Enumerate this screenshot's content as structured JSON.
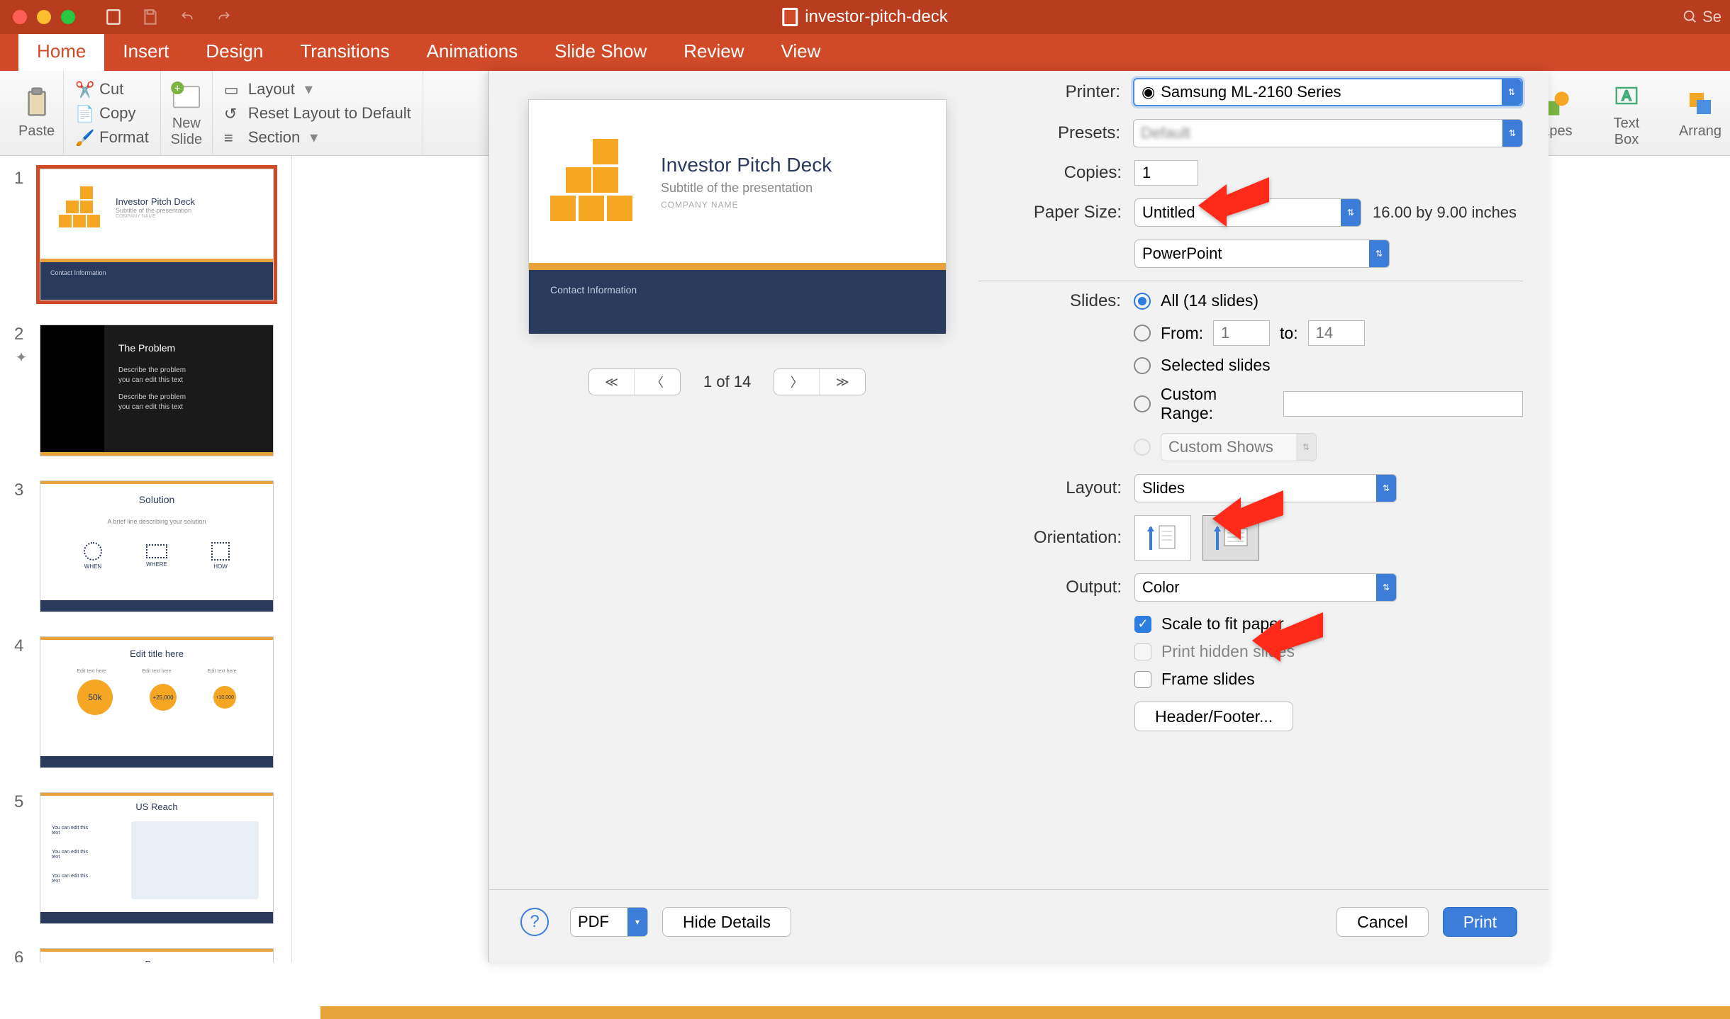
{
  "window": {
    "title": "investor-pitch-deck",
    "search_placeholder": "Se"
  },
  "tabs": {
    "home": "Home",
    "insert": "Insert",
    "design": "Design",
    "transitions": "Transitions",
    "animations": "Animations",
    "slideshow": "Slide Show",
    "review": "Review",
    "view": "View"
  },
  "ribbon": {
    "paste": "Paste",
    "cut": "Cut",
    "copy": "Copy",
    "format": "Format",
    "newslide": "New\nSlide",
    "layout": "Layout",
    "reset": "Reset Layout to Default",
    "section": "Section",
    "shapes": "apes",
    "textbox": "Text\nBox",
    "arrange": "Arrang"
  },
  "thumbs": [
    {
      "n": "1"
    },
    {
      "n": "2"
    },
    {
      "n": "3"
    },
    {
      "n": "4"
    },
    {
      "n": "5"
    },
    {
      "n": "6"
    }
  ],
  "slide2": {
    "title": "The Problem",
    "l1": "Describe the problem",
    "l2": "you can edit this text",
    "l3": "Describe the problem",
    "l4": "you can edit this text"
  },
  "slide3": {
    "title": "Solution",
    "sub": "A brief line describing your solution",
    "c1": "WHEN",
    "c2": "WHERE",
    "c3": "HOW"
  },
  "slide4": {
    "title": "Edit title here",
    "s1": "Edit text here",
    "s2": "Edit text here",
    "s3": "Edit text here",
    "v1": "50k",
    "v2": "+25,000",
    "v3": "+10,000"
  },
  "slide5": {
    "title": "US Reach",
    "t1": "You can edit this text",
    "t2": "You can edit this text",
    "t3": "You can edit this text"
  },
  "slide6": {
    "title": "Press"
  },
  "preview": {
    "title": "Investor Pitch Deck",
    "subtitle": "Subtitle of the presentation",
    "company": "COMPANY NAME",
    "footer": "Contact Information",
    "page_counter": "1 of 14"
  },
  "dialog": {
    "printer_label": "Printer:",
    "printer_value": "Samsung ML-2160 Series",
    "presets_label": "Presets:",
    "copies_label": "Copies:",
    "copies_value": "1",
    "papersize_label": "Paper Size:",
    "papersize_value": "Untitled",
    "papersize_dims": "16.00 by 9.00 inches",
    "app_value": "PowerPoint",
    "slides_label": "Slides:",
    "all_label": "All  (14 slides)",
    "from_label": "From:",
    "from_ph": "1",
    "to_label": "to:",
    "to_ph": "14",
    "selected_label": "Selected slides",
    "custom_range_label": "Custom Range:",
    "custom_shows_label": "Custom Shows",
    "layout_label": "Layout:",
    "layout_value": "Slides",
    "orientation_label": "Orientation:",
    "output_label": "Output:",
    "output_value": "Color",
    "scale_label": "Scale to fit paper",
    "hidden_label": "Print hidden slides",
    "frame_label": "Frame slides",
    "headerfooter": "Header/Footer...",
    "pdf": "PDF",
    "hide_details": "Hide Details",
    "cancel": "Cancel",
    "print": "Print"
  }
}
